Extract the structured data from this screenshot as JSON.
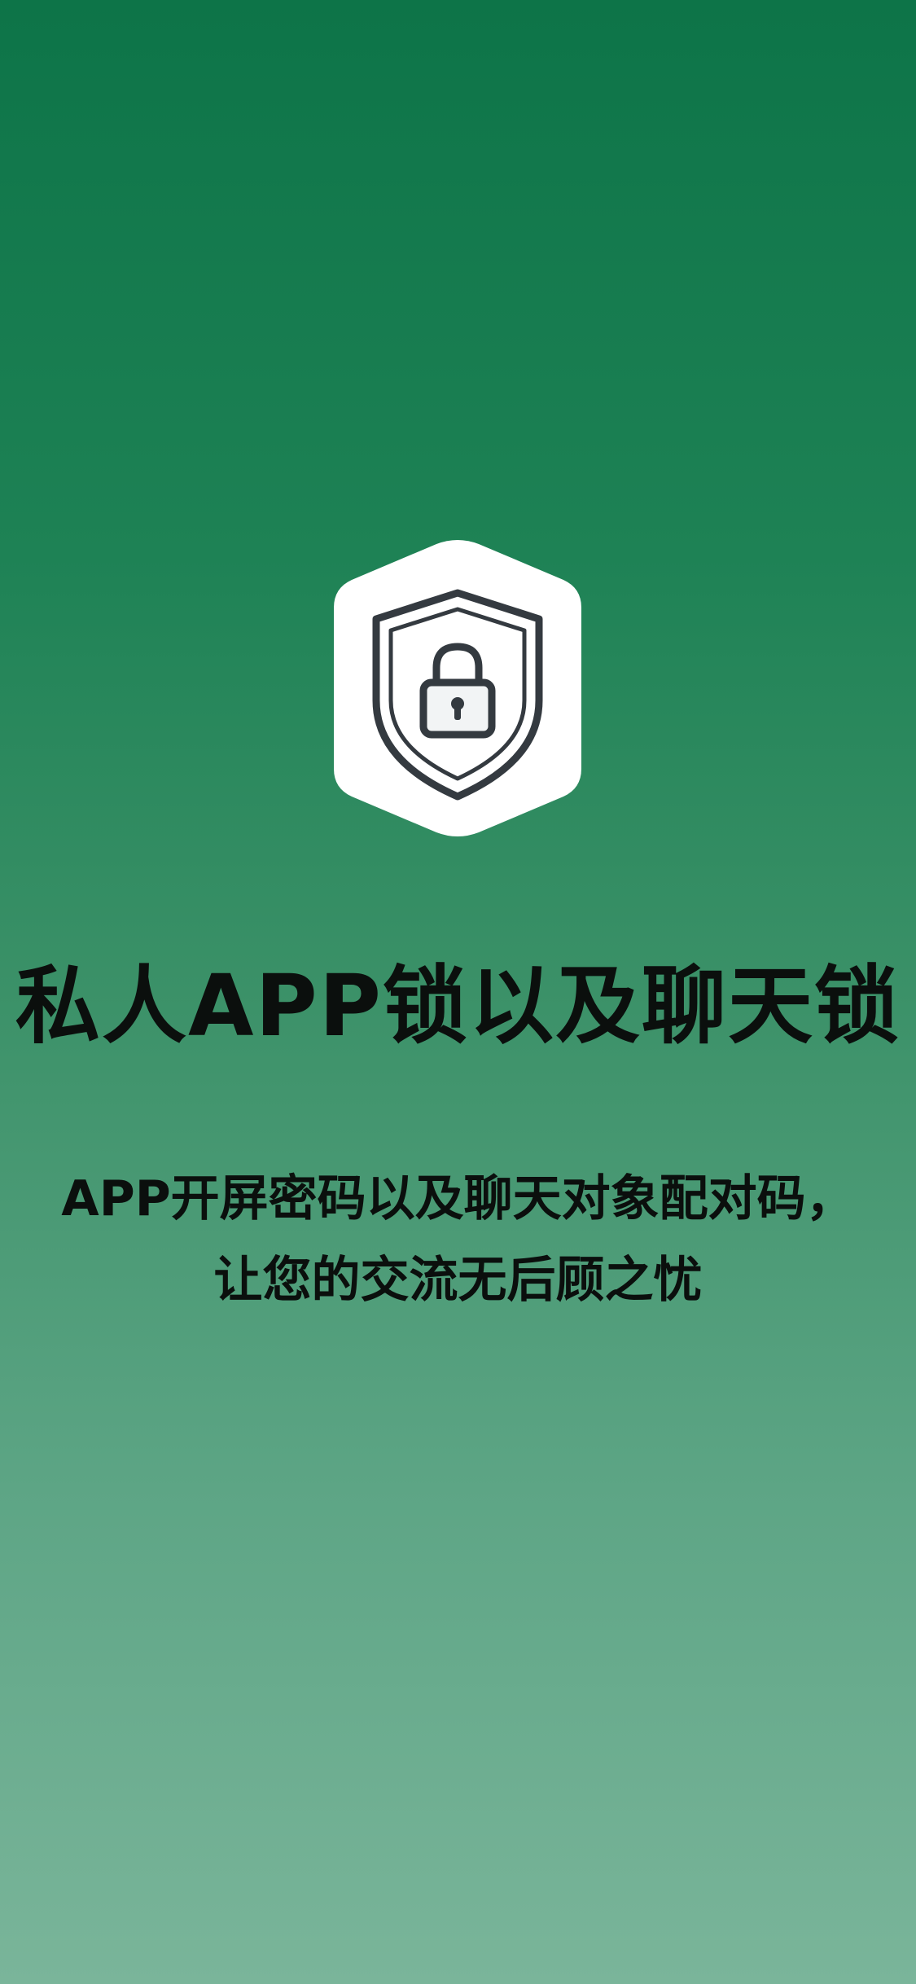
{
  "icon": "shield-lock-icon",
  "colors": {
    "gradient_top": "#0d7448",
    "gradient_bottom": "#7ab59a",
    "icon_background": "#ffffff",
    "icon_outline": "#343a40",
    "text": "#0b0f0d"
  },
  "headline": "私人APP锁以及聊天锁",
  "subtitle": {
    "line1": "APP开屏密码以及聊天对象配对码，",
    "line2": "让您的交流无后顾之忧"
  }
}
